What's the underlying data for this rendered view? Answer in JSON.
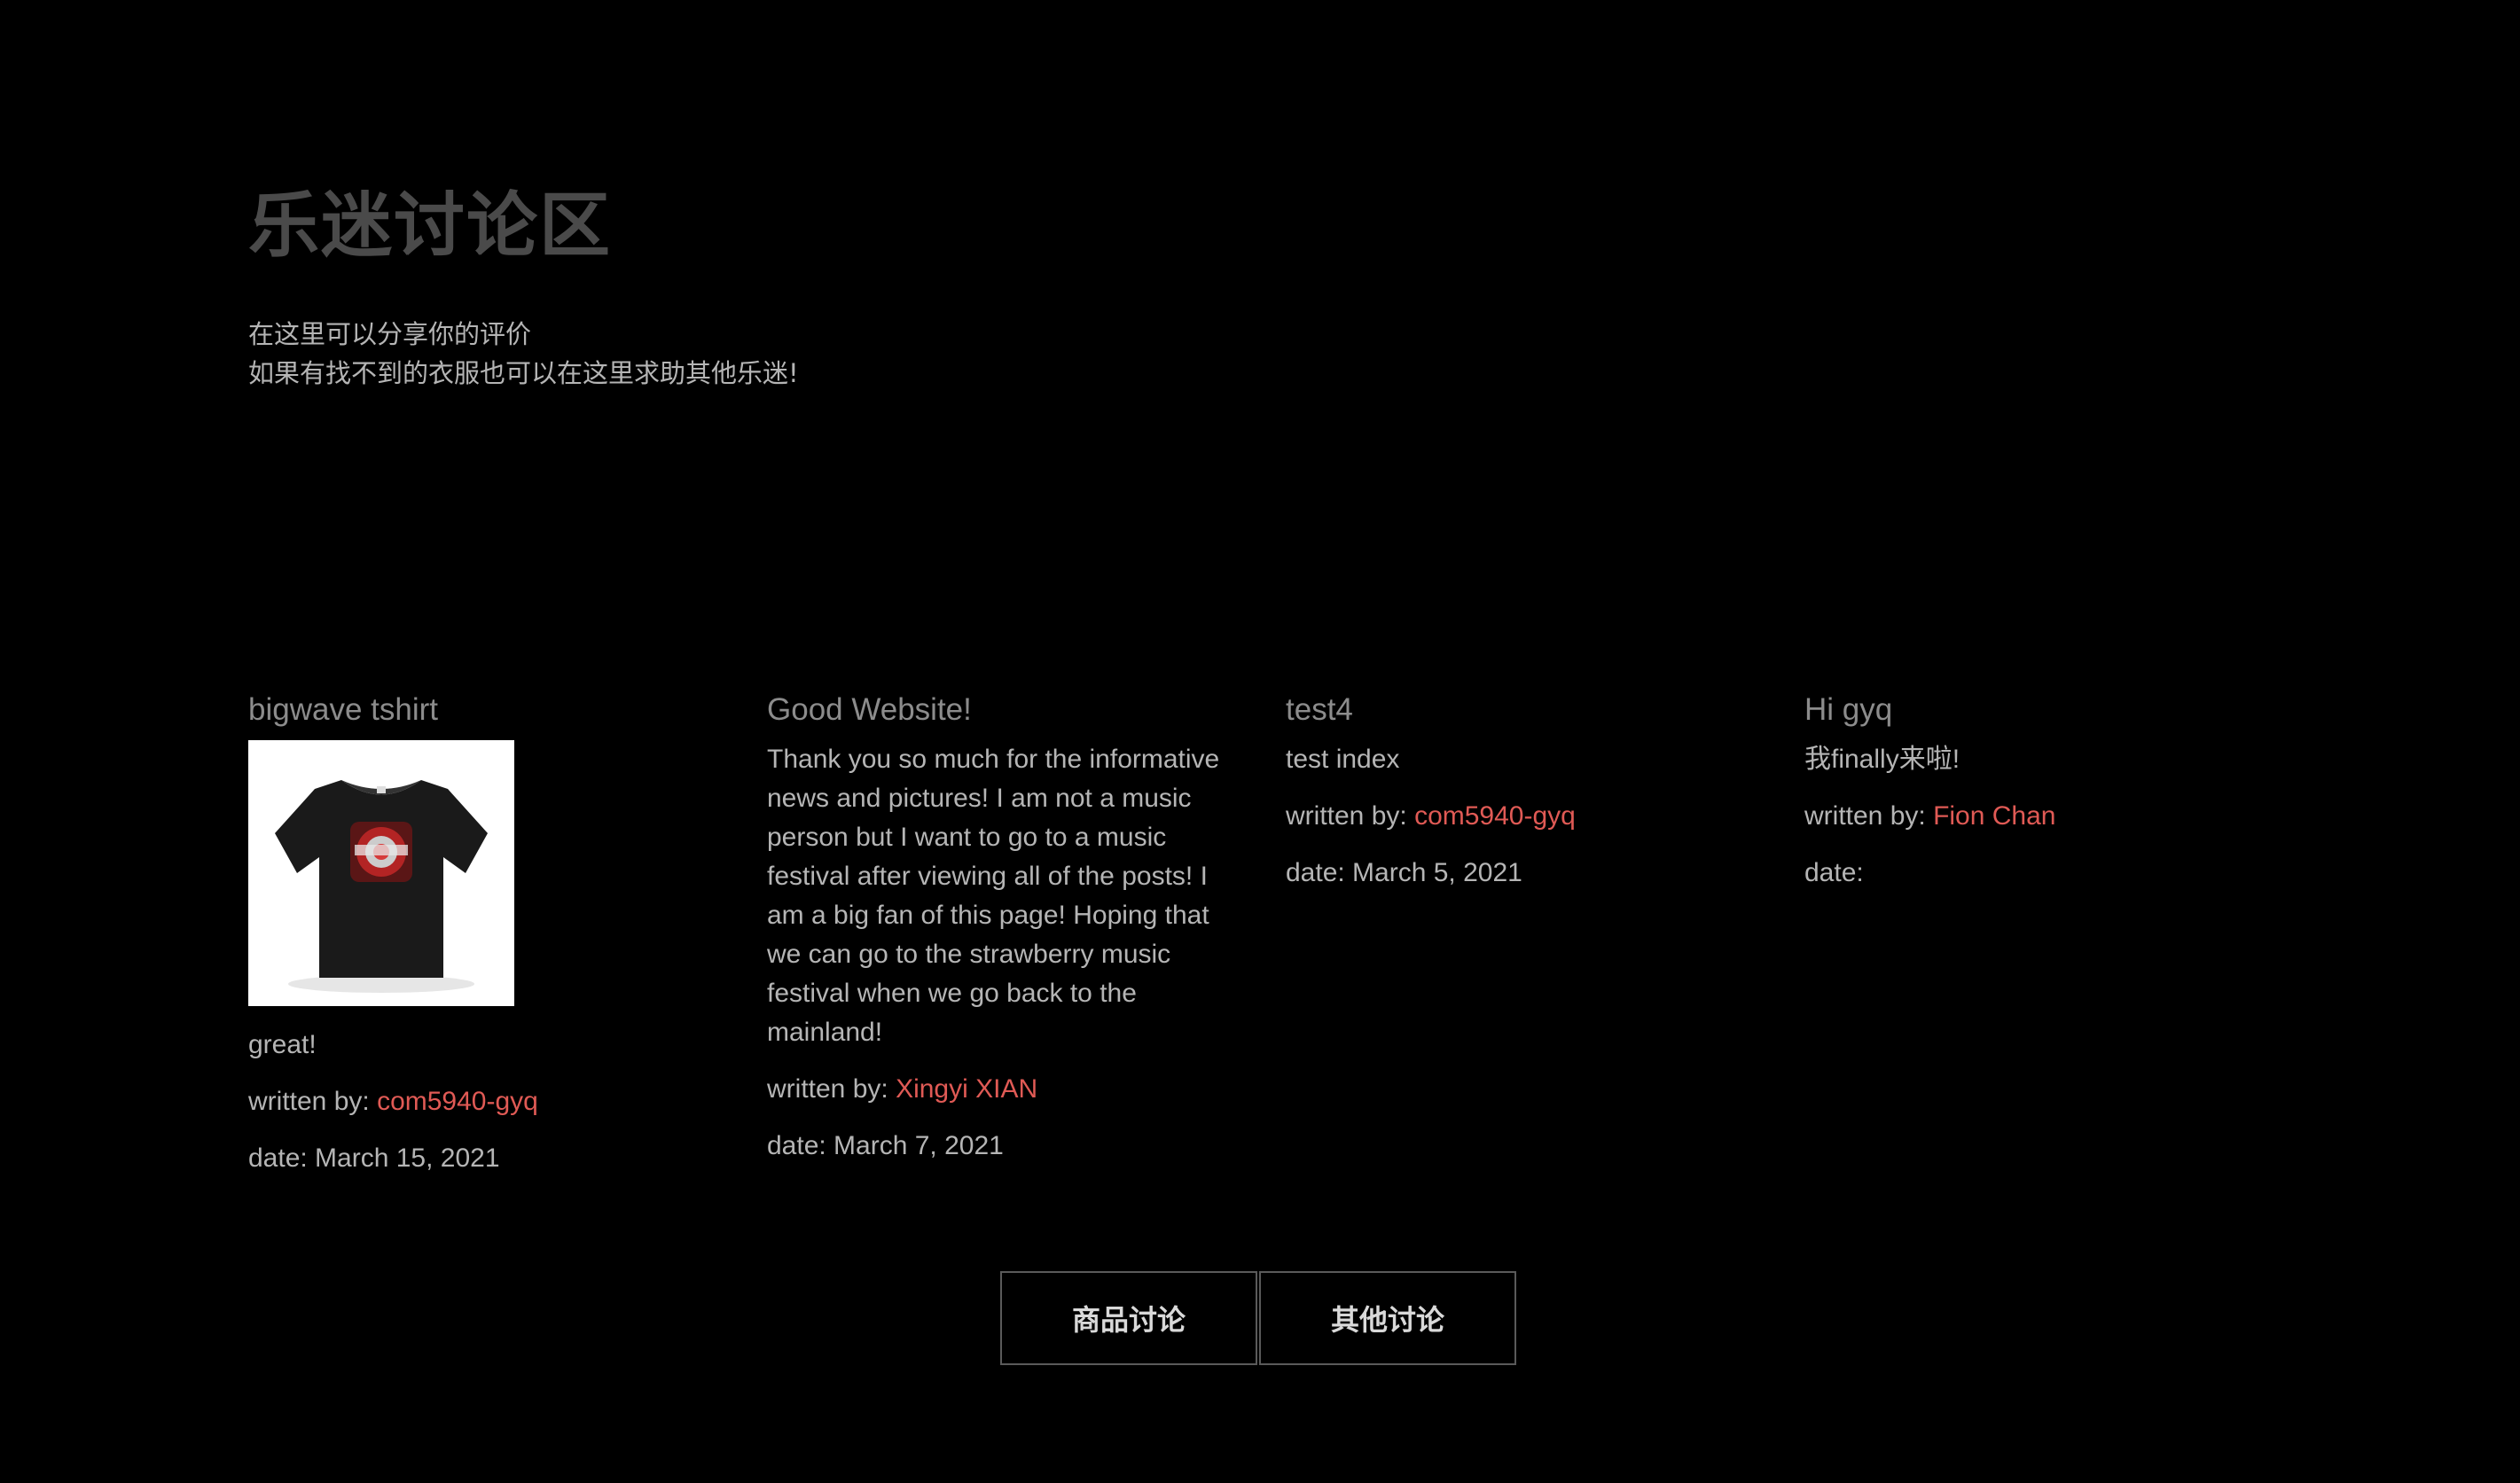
{
  "hero": {
    "title": "乐迷讨论区",
    "desc_line1": "在这里可以分享你的评价",
    "desc_line2": "如果有找不到的衣服也可以在这里求助其他乐迷!"
  },
  "posts": [
    {
      "title": "bigwave tshirt",
      "has_image": true,
      "image_icon": "tshirt-image",
      "body": "great!",
      "written_by_label": "written by: ",
      "author": "com5940-gyq",
      "date_label": "date: March 15, 2021"
    },
    {
      "title": "Good Website!",
      "body": "Thank you so much for the informative news and pictures! I am not a music person but I want to go to a music festival after viewing all of the posts! I am a big fan of this page! Hoping that we can go to the strawberry music festival when we go back to the mainland!",
      "written_by_label": "written by: ",
      "author": "Xingyi XIAN",
      "date_label": "date: March 7, 2021"
    },
    {
      "title": "test4",
      "body": "test index",
      "written_by_label": "written by: ",
      "author": "com5940-gyq",
      "date_label": "date: March 5, 2021"
    },
    {
      "title": "Hi gyq",
      "body": "我finally来啦!",
      "written_by_label": "written by: ",
      "author": "Fion Chan",
      "date_label": "date:"
    }
  ],
  "buttons": {
    "products": "商品讨论",
    "other": "其他讨论"
  },
  "colors": {
    "background": "#000000",
    "title": "#4a4a4a",
    "text": "#b5b5b5",
    "link": "#e05a55"
  }
}
